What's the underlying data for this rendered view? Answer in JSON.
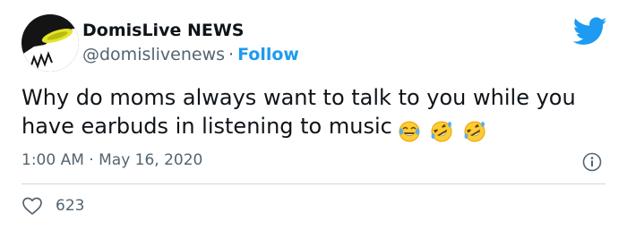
{
  "author": {
    "display_name": "DomisLive NEWS",
    "handle": "@domislivenews",
    "separator": "·",
    "follow_label": "Follow"
  },
  "tweet": {
    "text": "Why do moms always want to talk to you while you have earbuds in listening to music",
    "emojis": [
      "face-with-tears-of-joy",
      "rolling-on-floor-laughing",
      "rolling-on-floor-laughing"
    ],
    "time": "1:00 AM",
    "separator": "·",
    "date": "May 16, 2020"
  },
  "engagement": {
    "likes": "623"
  },
  "colors": {
    "accent": "#1d9bf0",
    "text_primary": "#0f1419",
    "text_secondary": "#536471",
    "divider": "#cfd9de"
  },
  "icons": {
    "brand": "twitter-bird-icon",
    "info": "info-icon",
    "like": "heart-outline-icon"
  }
}
